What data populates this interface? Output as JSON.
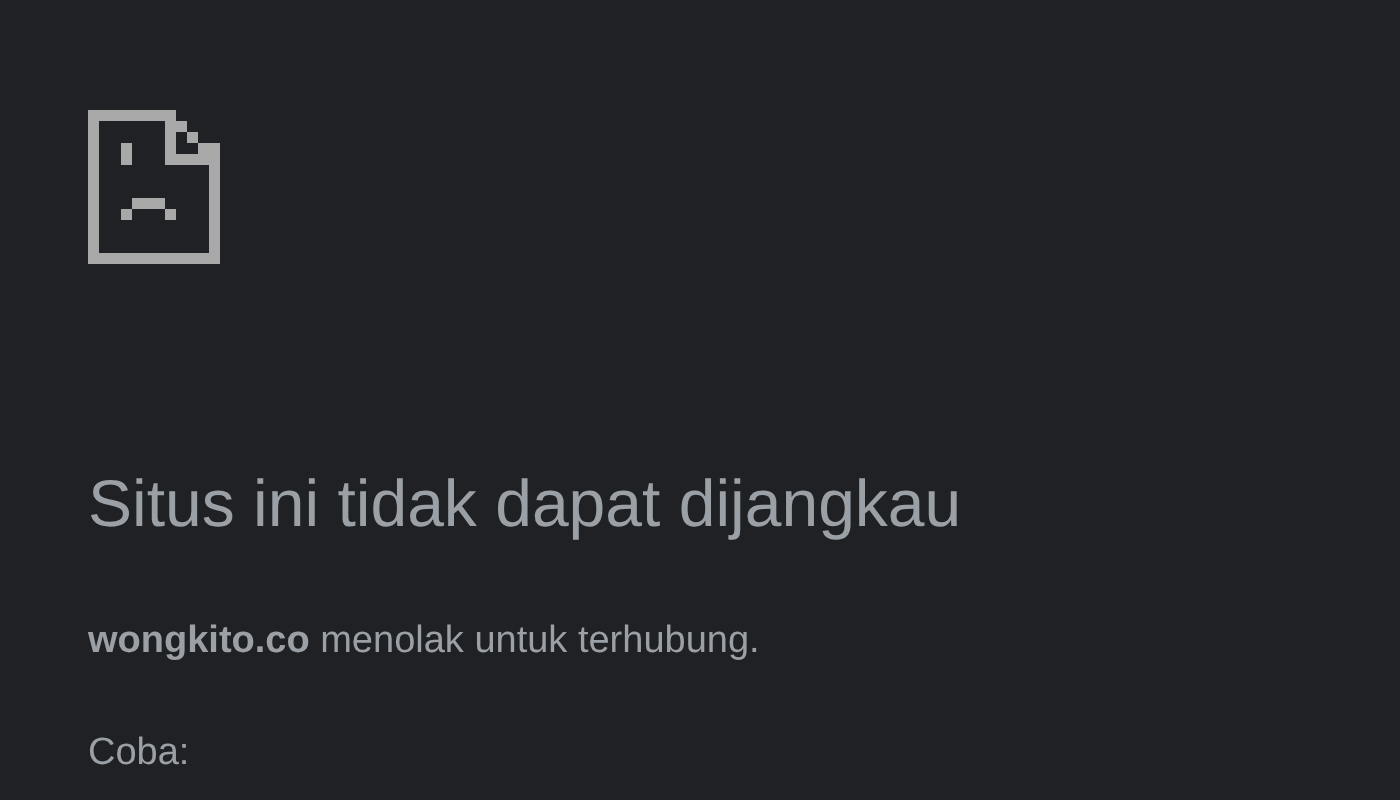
{
  "heading": "Situs ini tidak dapat dijangkau",
  "message": "**wongkito.co** menolak untuk terhubung.",
  "suggestions_label": "Coba:"
}
